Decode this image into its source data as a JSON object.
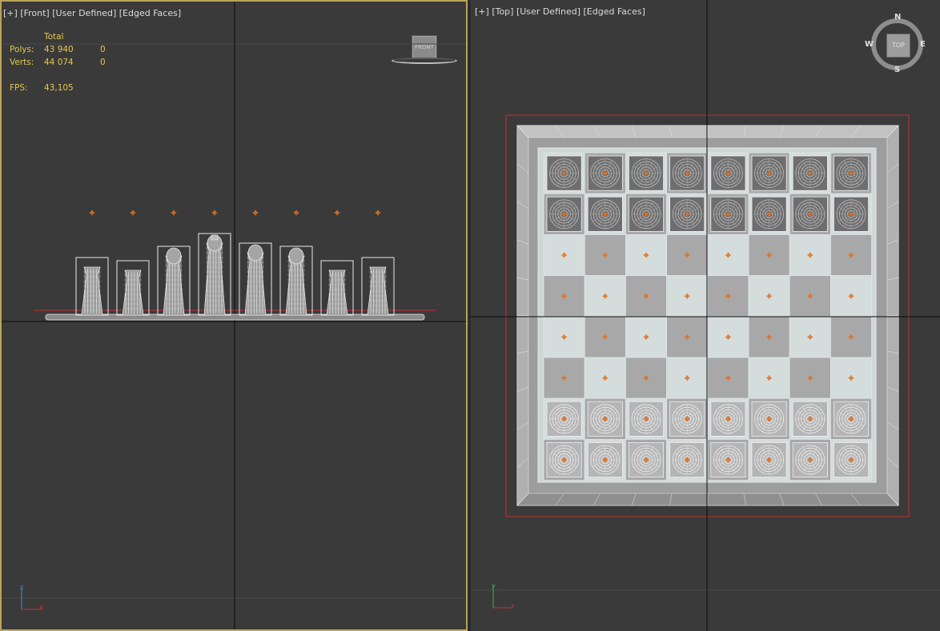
{
  "front_viewport": {
    "menu": "[+]",
    "view": "[Front]",
    "shading_mode": "[User Defined]",
    "display": "[Edged Faces]",
    "stats": {
      "header": "Total",
      "polys_label": "Polys:",
      "polys_total": "43 940",
      "polys_selected": "0",
      "verts_label": "Verts:",
      "verts_total": "44 074",
      "verts_selected": "0",
      "fps_label": "FPS:",
      "fps_value": "43,105"
    },
    "viewcube_label": "FRONT",
    "axis_labels": {
      "up": "z",
      "right": "x"
    }
  },
  "top_viewport": {
    "menu": "[+]",
    "view": "[Top]",
    "shading_mode": "[User Defined]",
    "display": "[Edged Faces]",
    "viewcube_label": "TOP",
    "compass": {
      "north": "N",
      "east": "E",
      "south": "S",
      "west": "W"
    },
    "axis_labels": {
      "up": "y",
      "right": "x"
    }
  },
  "colors": {
    "viewport_bg": "#3a3a3a",
    "active_border": "#b9a45a",
    "stats_text": "#e3c84a",
    "pivot": "#e07020",
    "selection_bbox": "#c03030",
    "board_light": "#d5dcdc",
    "board_dark": "#a8a8a8",
    "piece_wire": "#e6e6e6"
  },
  "pieces_front": [
    "rook",
    "knight",
    "bishop",
    "king",
    "queen",
    "bishop",
    "knight",
    "rook"
  ]
}
